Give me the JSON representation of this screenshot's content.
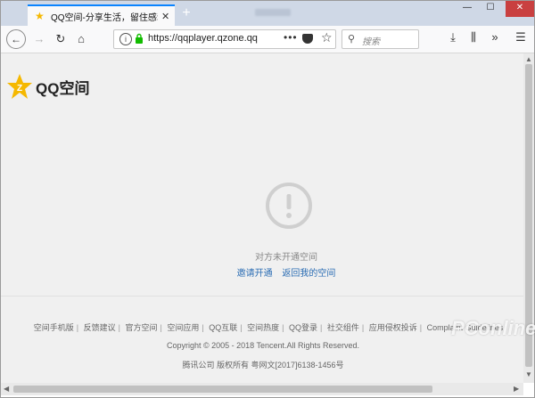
{
  "browser": {
    "tab": {
      "title": "QQ空间-分享生活，留住感动",
      "close": "✕"
    },
    "newtab": "+",
    "window_controls": {
      "minimize": "—",
      "maximize": "☐",
      "close": "✕"
    },
    "nav": {
      "back": "←",
      "forward": "→",
      "reload": "↻",
      "home": "⌂",
      "url": "https://qqplayer.qzone.qq",
      "page_actions": "•••",
      "search_placeholder": "搜索",
      "download": "⤓",
      "library": "⫼",
      "overflow": "»",
      "menu": "☰"
    }
  },
  "page": {
    "logo_text": "QQ空间",
    "message": "对方未开通空间",
    "links": [
      "邀请开通",
      "返回我的空间"
    ],
    "footer_links": [
      "空间手机版",
      "反馈建议",
      "官方空间",
      "空间应用",
      "QQ互联",
      "空间热度",
      "QQ登录",
      "社交组件",
      "应用侵权投诉",
      "Complaint Guidelines"
    ],
    "copyright": "Copyright © 2005 - 2018 Tencent.All Rights Reserved.",
    "icp": "腾讯公司 版权所有 粤网文[2017]6138-1456号"
  },
  "watermark": "PConline",
  "colors": {
    "accent": "#0a84ff",
    "link": "#2a6cb3",
    "lock": "#12bc00",
    "logo_star": "#f5b800"
  },
  "icons": [
    "info-icon",
    "lock-icon",
    "pocket-icon",
    "bookmark-star-icon",
    "search-icon",
    "alert-circle-icon",
    "qq-zone-star-logo"
  ]
}
